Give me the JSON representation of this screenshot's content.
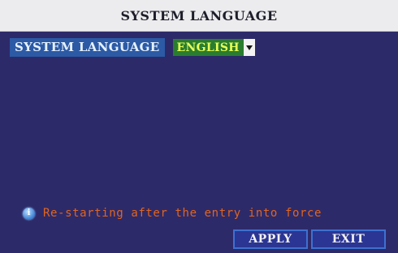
{
  "window": {
    "title": "SYSTEM LANGUAGE"
  },
  "setting": {
    "label": "SYSTEM LANGUAGE",
    "selected_value": "ENGLISH",
    "arrow_icon": "triangle-down-icon"
  },
  "notice": {
    "icon": "info-icon",
    "icon_glyph": "i",
    "text": "Re-starting after the entry into force"
  },
  "buttons": {
    "apply_label": "APPLY",
    "exit_label": "EXIT"
  },
  "colors": {
    "background": "#2d2a6a",
    "title_bar": "#ececee",
    "label_bg": "#2c5aa5",
    "dropdown_bg": "#2a7d2f",
    "dropdown_text": "#e8ff57",
    "notice_text": "#e0651f",
    "button_border": "#3e70d0"
  }
}
